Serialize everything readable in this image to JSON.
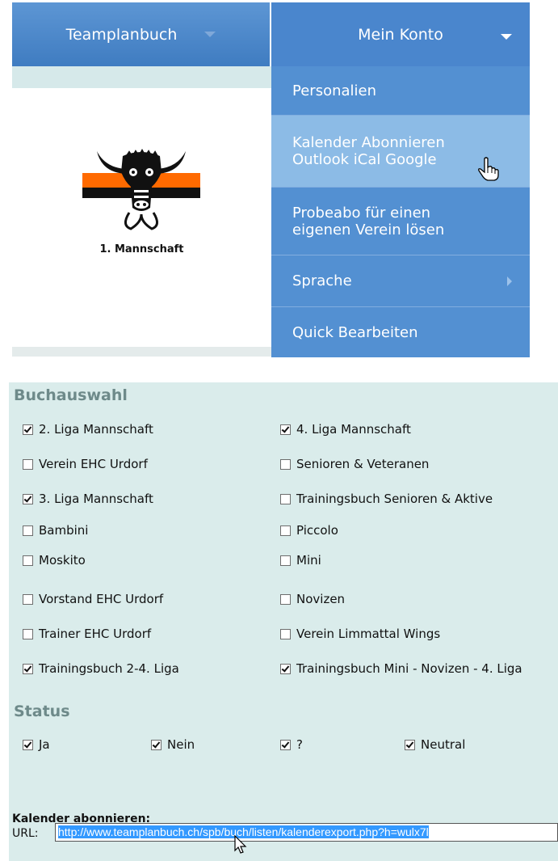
{
  "nav": {
    "brand": "Teamplanbuch",
    "account": "Mein Konto"
  },
  "menu": {
    "items": [
      {
        "lines": [
          "Personalien"
        ]
      },
      {
        "lines": [
          "Kalender Abonnieren",
          "Outlook iCal Google"
        ]
      },
      {
        "lines": [
          "Probeabo für einen",
          "eigenen Verein lösen"
        ]
      },
      {
        "lines": [
          "Sprache"
        ]
      },
      {
        "lines": [
          "Quick Bearbeiten"
        ]
      }
    ]
  },
  "team": {
    "caption": "1. Mannschaft"
  },
  "buchauswahl": {
    "title": "Buchauswahl",
    "books": [
      {
        "label": "2. Liga Mannschaft",
        "checked": true
      },
      {
        "label": "4. Liga Mannschaft",
        "checked": true
      },
      {
        "label": "Verein EHC Urdorf",
        "checked": false
      },
      {
        "label": "Senioren & Veteranen",
        "checked": false
      },
      {
        "label": "3. Liga Mannschaft",
        "checked": true
      },
      {
        "label": "Trainingsbuch Senioren & Aktive",
        "checked": false
      },
      {
        "label": "Bambini",
        "checked": false
      },
      {
        "label": "Piccolo",
        "checked": false
      },
      {
        "label": "Moskito",
        "checked": false
      },
      {
        "label": "Mini",
        "checked": false
      },
      {
        "label": "Vorstand EHC Urdorf",
        "checked": false
      },
      {
        "label": "Novizen",
        "checked": false
      },
      {
        "label": "Trainer EHC Urdorf",
        "checked": false
      },
      {
        "label": "Verein Limmattal Wings",
        "checked": false
      },
      {
        "label": "Trainingsbuch 2-4. Liga",
        "checked": true
      },
      {
        "label": "Trainingsbuch Mini - Novizen - 4. Liga",
        "checked": true
      }
    ]
  },
  "status": {
    "title": "Status",
    "options": [
      {
        "label": "Ja",
        "checked": true
      },
      {
        "label": "Nein",
        "checked": true
      },
      {
        "label": "?",
        "checked": true
      },
      {
        "label": "Neutral",
        "checked": true
      }
    ]
  },
  "subscribe": {
    "title": "Kalender abonnieren:",
    "url_label": "URL:",
    "url_value": "http://www.teamplanbuch.ch/spb/buch/listen/kalenderexport.php?h=wulx7l"
  },
  "colors": {
    "nav_blue": "#4a86cd",
    "menu_blue": "#5390d2",
    "menu_hover": "#8cbbe6",
    "panel_bg": "#daeceb",
    "section_title": "#6e8a8a"
  }
}
